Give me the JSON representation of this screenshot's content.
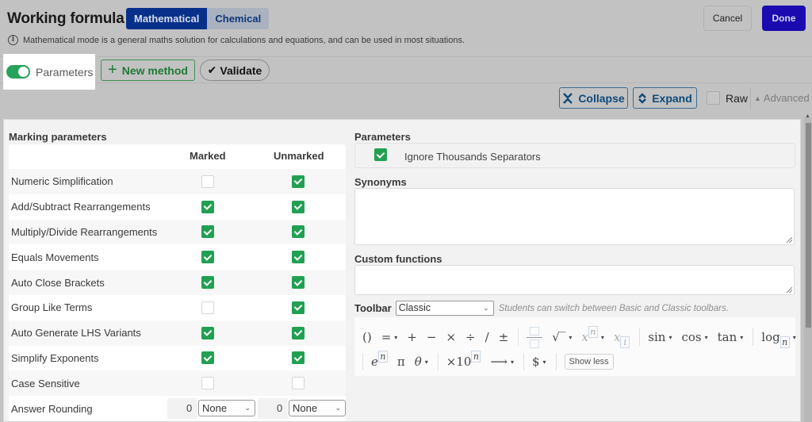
{
  "header": {
    "title": "Working formula",
    "modes": [
      {
        "label": "Mathematical",
        "active": true
      },
      {
        "label": "Chemical",
        "active": false
      }
    ],
    "info_text": "Mathematical mode is a general maths solution for calculations and equations, and can be used in most situations.",
    "info_icon": "i",
    "cancel_label": "Cancel",
    "done_label": "Done"
  },
  "toolbar": {
    "parameters_label": "Parameters",
    "parameters_on": true,
    "new_method_icon": "+",
    "new_method_label": "New method",
    "validate_icon": "✔",
    "validate_label": "Validate",
    "collapse_icon": "⨯",
    "collapse_label": "Collapse",
    "expand_icon": "⇕",
    "expand_label": "Expand",
    "raw_label": "Raw",
    "raw_checked": false,
    "advanced_icon": "▲",
    "advanced_label": "Advanced"
  },
  "marking": {
    "title": "Marking parameters",
    "columns": [
      "Marked",
      "Unmarked"
    ],
    "rows": [
      {
        "label": "Numeric Simplification",
        "marked": false,
        "unmarked": true
      },
      {
        "label": "Add/Subtract Rearrangements",
        "marked": true,
        "unmarked": true
      },
      {
        "label": "Multiply/Divide Rearrangements",
        "marked": true,
        "unmarked": true
      },
      {
        "label": "Equals Movements",
        "marked": true,
        "unmarked": true
      },
      {
        "label": "Auto Close Brackets",
        "marked": true,
        "unmarked": true
      },
      {
        "label": "Group Like Terms",
        "marked": false,
        "unmarked": true
      },
      {
        "label": "Auto Generate LHS Variants",
        "marked": true,
        "unmarked": true
      },
      {
        "label": "Simplify Exponents",
        "marked": true,
        "unmarked": true
      },
      {
        "label": "Case Sensitive",
        "marked": false,
        "unmarked": false
      }
    ],
    "rounding": {
      "label": "Answer Rounding",
      "marked_value": "0",
      "marked_option": "None",
      "unmarked_value": "0",
      "unmarked_option": "None"
    }
  },
  "parameters": {
    "title": "Parameters",
    "items": [
      {
        "label": "Ignore Thousands Separators",
        "checked": true
      }
    ]
  },
  "synonyms": {
    "title": "Synonyms",
    "value": ""
  },
  "custom_functions": {
    "title": "Custom functions",
    "value": ""
  },
  "math_toolbar": {
    "label": "Toolbar",
    "selected": "Classic",
    "hint": "Students can switch between Basic and Classic toolbars.",
    "line1": {
      "parens": "()",
      "equals": "=",
      "plus": "+",
      "minus": "−",
      "times": "×",
      "divide": "÷",
      "slash": "/",
      "plusminus": "±",
      "sqrt": "√‾",
      "power_base": "x",
      "power_exp": "n",
      "sub_base": "x",
      "sub_idx": "i",
      "sin": "sin",
      "cos": "cos",
      "tan": "tan",
      "log": "log",
      "log_base": "n"
    },
    "line2": {
      "e_base": "e",
      "e_exp": "n",
      "pi": "π",
      "theta": "θ",
      "sci": "×10",
      "sci_exp": "n",
      "arrow": "⟶",
      "currency": "$",
      "show_less": "Show less"
    },
    "dropdown_glyph": "▾"
  }
}
